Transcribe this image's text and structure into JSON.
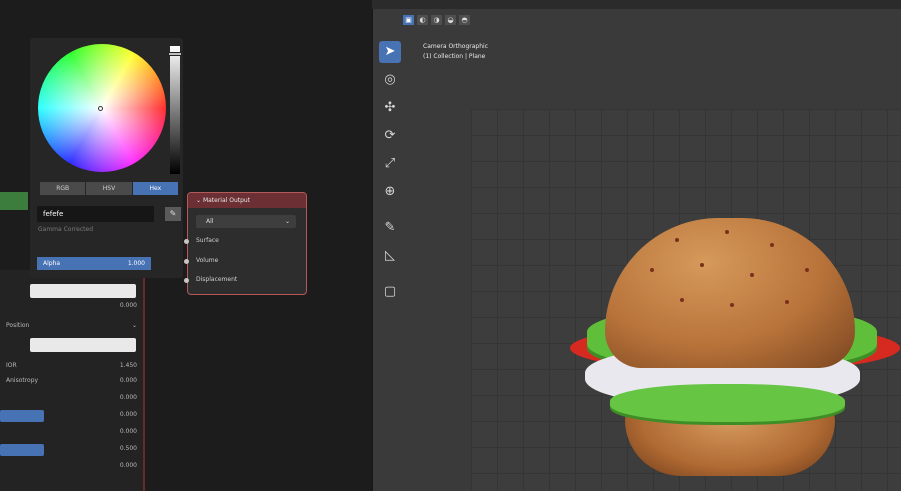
{
  "color_picker": {
    "mode_tabs": [
      "RGB",
      "HSV",
      "Hex"
    ],
    "active_mode": "Hex",
    "hex_value": "fefefe",
    "hint": "Gamma Corrected",
    "alpha_label": "Alpha",
    "alpha_value": "1.000"
  },
  "material_node": {
    "title": "Material Output",
    "target": "All",
    "sockets": [
      "Surface",
      "Volume",
      "Displacement"
    ]
  },
  "properties": {
    "rows": [
      {
        "label": "",
        "value": "0.000"
      },
      {
        "label": "Position",
        "value": ""
      },
      {
        "label": "",
        "value": ""
      },
      {
        "label": "IOR",
        "value": "1.450"
      },
      {
        "label": "Anisotropy",
        "value": "0.000"
      },
      {
        "label": "",
        "value": "0.000"
      },
      {
        "label": "",
        "value": "0.000"
      },
      {
        "label": "",
        "value": "0.000"
      },
      {
        "label": "",
        "value": "0.500"
      },
      {
        "label": "",
        "value": "0.000"
      }
    ]
  },
  "viewport": {
    "header_buttons": [
      "▣",
      "◐",
      "◑",
      "◒",
      "◓"
    ],
    "info_line1": "Camera Orthographic",
    "info_line2": "(1) Collection | Plane",
    "tools": [
      {
        "name": "select-tool-icon",
        "glyph": "➤"
      },
      {
        "name": "cursor-tool-icon",
        "glyph": "◎"
      },
      {
        "name": "move-tool-icon",
        "glyph": "✣"
      },
      {
        "name": "rotate-tool-icon",
        "glyph": "⟳"
      },
      {
        "name": "scale-tool-icon",
        "glyph": "⤢"
      },
      {
        "name": "transform-tool-icon",
        "glyph": "⊕"
      },
      {
        "name": "annotate-tool-icon",
        "glyph": "✎"
      },
      {
        "name": "measure-tool-icon",
        "glyph": "◺"
      },
      {
        "name": "add-cube-tool-icon",
        "glyph": "▢"
      }
    ]
  },
  "colors": {
    "accent": "#4772b3",
    "node_header": "#6b2f34",
    "node_border": "#b45a5a"
  }
}
